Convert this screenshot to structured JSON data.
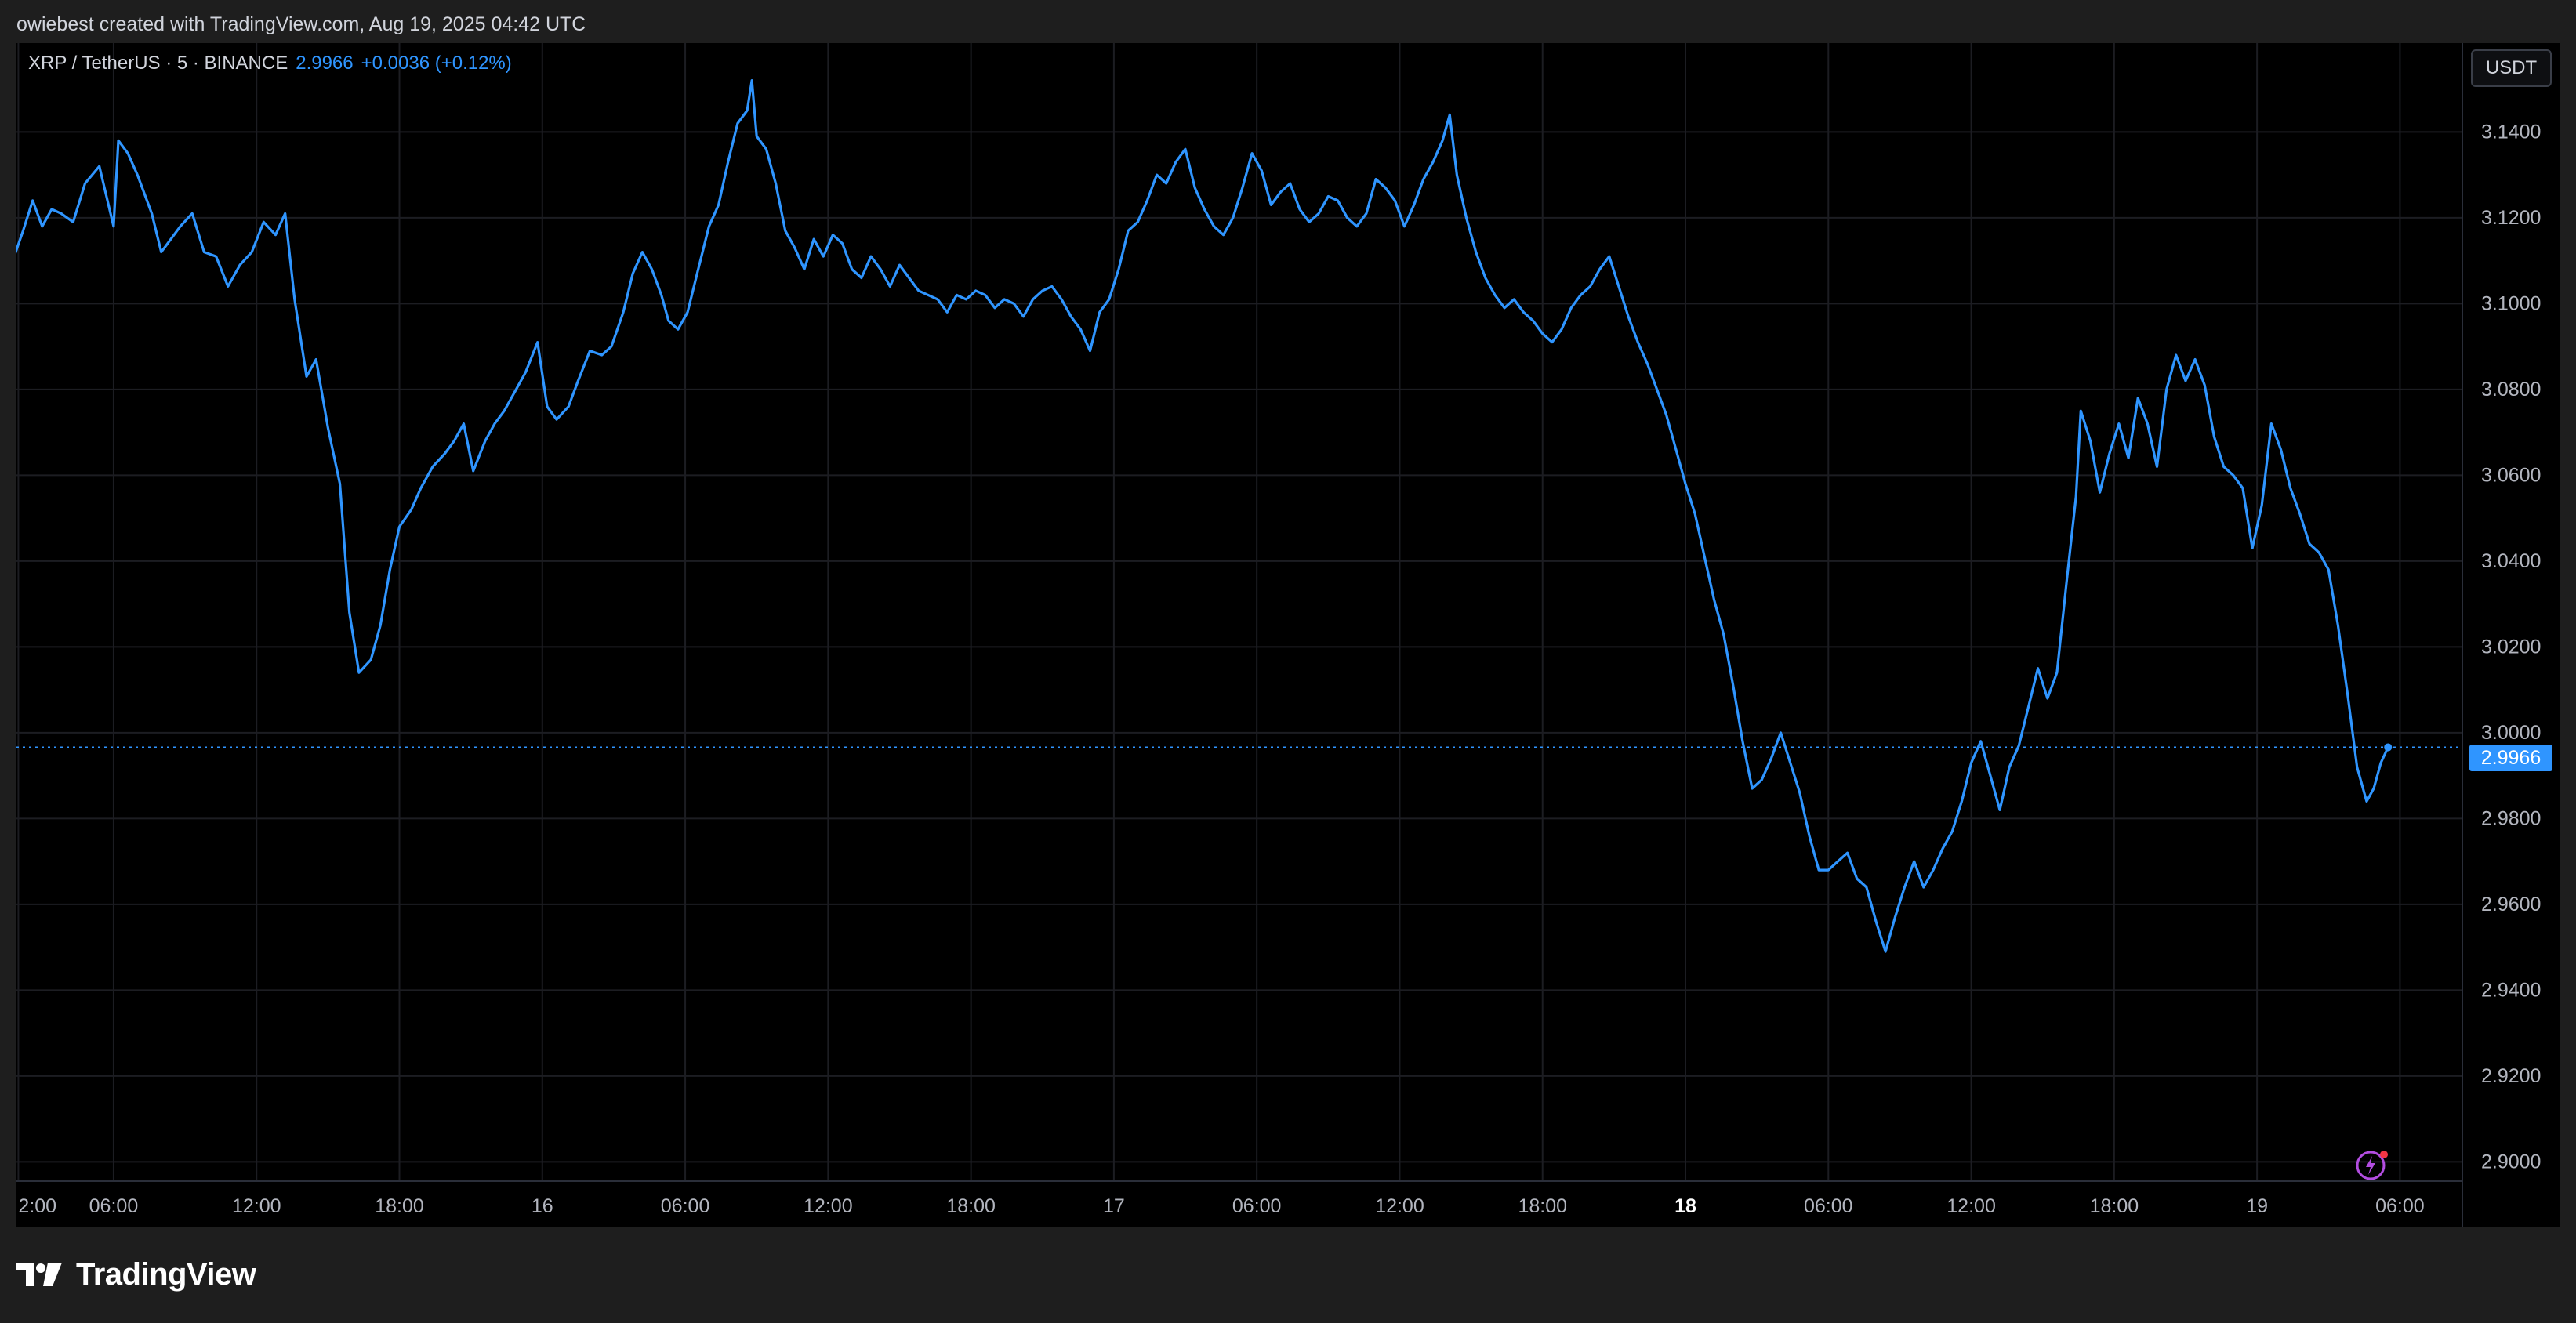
{
  "header": {
    "attribution": "owiebest created with TradingView.com, Aug 19, 2025 04:42 UTC"
  },
  "legend": {
    "symbol": "XRP / TetherUS · 5 · BINANCE",
    "price": "2.9966",
    "change": "+0.0036 (+0.12%)"
  },
  "currency_button": "USDT",
  "last_price_badge": "2.9966",
  "footer": {
    "brand": "TradingView",
    "logo_icon": "tradingview-logo-icon"
  },
  "colors": {
    "line": "#2f95ff",
    "background": "#000000",
    "grid": "#1c1d22",
    "axis_text": "#b2b5be"
  },
  "chart_data": {
    "type": "line",
    "symbol": "XRP / TetherUS",
    "interval": "5",
    "exchange": "BINANCE",
    "y_ticks": [
      "3.1400",
      "3.1200",
      "3.1000",
      "3.0800",
      "3.0600",
      "3.0400",
      "3.0200",
      "3.0000",
      "2.9800",
      "2.9600",
      "2.9400",
      "2.9200",
      "2.9000"
    ],
    "y_tick_values": [
      3.14,
      3.12,
      3.1,
      3.08,
      3.06,
      3.04,
      3.02,
      3.0,
      2.98,
      2.96,
      2.94,
      2.92,
      2.9
    ],
    "ylim": [
      2.8955,
      3.1607
    ],
    "x_ticks": [
      {
        "label": "2:00",
        "t": 2
      },
      {
        "label": "06:00",
        "t": 6
      },
      {
        "label": "12:00",
        "t": 12
      },
      {
        "label": "18:00",
        "t": 18
      },
      {
        "label": "16",
        "t": 24,
        "bold": false
      },
      {
        "label": "06:00",
        "t": 30
      },
      {
        "label": "12:00",
        "t": 36
      },
      {
        "label": "18:00",
        "t": 42
      },
      {
        "label": "17",
        "t": 48
      },
      {
        "label": "06:00",
        "t": 54
      },
      {
        "label": "12:00",
        "t": 60
      },
      {
        "label": "18:00",
        "t": 66
      },
      {
        "label": "18",
        "t": 72,
        "bold": true
      },
      {
        "label": "06:00",
        "t": 78
      },
      {
        "label": "12:00",
        "t": 84
      },
      {
        "label": "18:00",
        "t": 90
      },
      {
        "label": "19",
        "t": 96
      },
      {
        "label": "06:00",
        "t": 102
      }
    ],
    "xlim": [
      1.92,
      104.62
    ],
    "last_price": 2.9966,
    "series": [
      {
        "values": [
          [
            0.1,
            3.093
          ],
          [
            0.8,
            3.101
          ],
          [
            1.7,
            3.109
          ],
          [
            2.2,
            3.117
          ],
          [
            2.6,
            3.124
          ],
          [
            3.0,
            3.118
          ],
          [
            3.4,
            3.122
          ],
          [
            3.8,
            3.121
          ],
          [
            4.3,
            3.119
          ],
          [
            4.8,
            3.128
          ],
          [
            5.4,
            3.132
          ],
          [
            6.0,
            3.118
          ],
          [
            6.2,
            3.138
          ],
          [
            6.6,
            3.135
          ],
          [
            7.0,
            3.13
          ],
          [
            7.6,
            3.121
          ],
          [
            8.0,
            3.112
          ],
          [
            8.4,
            3.115
          ],
          [
            8.8,
            3.118
          ],
          [
            9.3,
            3.121
          ],
          [
            9.8,
            3.112
          ],
          [
            10.3,
            3.111
          ],
          [
            10.8,
            3.104
          ],
          [
            11.3,
            3.109
          ],
          [
            11.8,
            3.112
          ],
          [
            12.3,
            3.119
          ],
          [
            12.8,
            3.116
          ],
          [
            13.2,
            3.121
          ],
          [
            13.6,
            3.101
          ],
          [
            14.1,
            3.083
          ],
          [
            14.5,
            3.087
          ],
          [
            15.0,
            3.071
          ],
          [
            15.5,
            3.058
          ],
          [
            15.9,
            3.028
          ],
          [
            16.3,
            3.014
          ],
          [
            16.8,
            3.017
          ],
          [
            17.2,
            3.025
          ],
          [
            17.6,
            3.038
          ],
          [
            18.0,
            3.048
          ],
          [
            18.5,
            3.052
          ],
          [
            18.9,
            3.057
          ],
          [
            19.4,
            3.062
          ],
          [
            19.9,
            3.065
          ],
          [
            20.3,
            3.068
          ],
          [
            20.7,
            3.072
          ],
          [
            21.1,
            3.061
          ],
          [
            21.6,
            3.068
          ],
          [
            22.0,
            3.072
          ],
          [
            22.4,
            3.075
          ],
          [
            22.9,
            3.08
          ],
          [
            23.3,
            3.084
          ],
          [
            23.8,
            3.091
          ],
          [
            24.2,
            3.076
          ],
          [
            24.6,
            3.073
          ],
          [
            25.1,
            3.076
          ],
          [
            25.5,
            3.082
          ],
          [
            26.0,
            3.089
          ],
          [
            26.5,
            3.088
          ],
          [
            26.9,
            3.09
          ],
          [
            27.4,
            3.098
          ],
          [
            27.8,
            3.107
          ],
          [
            28.2,
            3.112
          ],
          [
            28.6,
            3.108
          ],
          [
            29.0,
            3.102
          ],
          [
            29.3,
            3.096
          ],
          [
            29.7,
            3.094
          ],
          [
            30.1,
            3.098
          ],
          [
            30.5,
            3.107
          ],
          [
            31.0,
            3.118
          ],
          [
            31.4,
            3.123
          ],
          [
            31.8,
            3.133
          ],
          [
            32.2,
            3.142
          ],
          [
            32.6,
            3.145
          ],
          [
            32.8,
            3.152
          ],
          [
            33.0,
            3.139
          ],
          [
            33.4,
            3.136
          ],
          [
            33.8,
            3.128
          ],
          [
            34.2,
            3.117
          ],
          [
            34.6,
            3.113
          ],
          [
            35.0,
            3.108
          ],
          [
            35.4,
            3.115
          ],
          [
            35.8,
            3.111
          ],
          [
            36.2,
            3.116
          ],
          [
            36.6,
            3.114
          ],
          [
            37.0,
            3.108
          ],
          [
            37.4,
            3.106
          ],
          [
            37.8,
            3.111
          ],
          [
            38.2,
            3.108
          ],
          [
            38.6,
            3.104
          ],
          [
            39.0,
            3.109
          ],
          [
            39.4,
            3.106
          ],
          [
            39.8,
            3.103
          ],
          [
            40.2,
            3.102
          ],
          [
            40.6,
            3.101
          ],
          [
            41.0,
            3.098
          ],
          [
            41.4,
            3.102
          ],
          [
            41.8,
            3.101
          ],
          [
            42.2,
            3.103
          ],
          [
            42.6,
            3.102
          ],
          [
            43.0,
            3.099
          ],
          [
            43.4,
            3.101
          ],
          [
            43.8,
            3.1
          ],
          [
            44.2,
            3.097
          ],
          [
            44.6,
            3.101
          ],
          [
            45.0,
            3.103
          ],
          [
            45.4,
            3.104
          ],
          [
            45.8,
            3.101
          ],
          [
            46.2,
            3.097
          ],
          [
            46.6,
            3.094
          ],
          [
            47.0,
            3.089
          ],
          [
            47.4,
            3.098
          ],
          [
            47.8,
            3.101
          ],
          [
            48.2,
            3.108
          ],
          [
            48.6,
            3.117
          ],
          [
            49.0,
            3.119
          ],
          [
            49.4,
            3.124
          ],
          [
            49.8,
            3.13
          ],
          [
            50.2,
            3.128
          ],
          [
            50.6,
            3.133
          ],
          [
            51.0,
            3.136
          ],
          [
            51.4,
            3.127
          ],
          [
            51.8,
            3.122
          ],
          [
            52.2,
            3.118
          ],
          [
            52.6,
            3.116
          ],
          [
            53.0,
            3.12
          ],
          [
            53.4,
            3.127
          ],
          [
            53.8,
            3.135
          ],
          [
            54.2,
            3.131
          ],
          [
            54.6,
            3.123
          ],
          [
            55.0,
            3.126
          ],
          [
            55.4,
            3.128
          ],
          [
            55.8,
            3.122
          ],
          [
            56.2,
            3.119
          ],
          [
            56.6,
            3.121
          ],
          [
            57.0,
            3.125
          ],
          [
            57.4,
            3.124
          ],
          [
            57.8,
            3.12
          ],
          [
            58.2,
            3.118
          ],
          [
            58.6,
            3.121
          ],
          [
            59.0,
            3.129
          ],
          [
            59.4,
            3.127
          ],
          [
            59.8,
            3.124
          ],
          [
            60.2,
            3.118
          ],
          [
            60.6,
            3.123
          ],
          [
            61.0,
            3.129
          ],
          [
            61.4,
            3.133
          ],
          [
            61.8,
            3.138
          ],
          [
            62.1,
            3.144
          ],
          [
            62.4,
            3.13
          ],
          [
            62.8,
            3.12
          ],
          [
            63.2,
            3.112
          ],
          [
            63.6,
            3.106
          ],
          [
            64.0,
            3.102
          ],
          [
            64.4,
            3.099
          ],
          [
            64.8,
            3.101
          ],
          [
            65.2,
            3.098
          ],
          [
            65.6,
            3.096
          ],
          [
            66.0,
            3.093
          ],
          [
            66.4,
            3.091
          ],
          [
            66.8,
            3.094
          ],
          [
            67.2,
            3.099
          ],
          [
            67.6,
            3.102
          ],
          [
            68.0,
            3.104
          ],
          [
            68.4,
            3.108
          ],
          [
            68.8,
            3.111
          ],
          [
            69.2,
            3.104
          ],
          [
            69.6,
            3.097
          ],
          [
            70.0,
            3.091
          ],
          [
            70.4,
            3.086
          ],
          [
            70.8,
            3.08
          ],
          [
            71.2,
            3.074
          ],
          [
            71.6,
            3.066
          ],
          [
            72.0,
            3.058
          ],
          [
            72.4,
            3.051
          ],
          [
            72.8,
            3.041
          ],
          [
            73.2,
            3.031
          ],
          [
            73.6,
            3.023
          ],
          [
            74.0,
            3.011
          ],
          [
            74.4,
            2.998
          ],
          [
            74.8,
            2.987
          ],
          [
            75.2,
            2.989
          ],
          [
            75.6,
            2.994
          ],
          [
            76.0,
            3.0
          ],
          [
            76.4,
            2.993
          ],
          [
            76.8,
            2.986
          ],
          [
            77.2,
            2.976
          ],
          [
            77.6,
            2.968
          ],
          [
            78.0,
            2.968
          ],
          [
            78.4,
            2.97
          ],
          [
            78.8,
            2.972
          ],
          [
            79.2,
            2.966
          ],
          [
            79.6,
            2.964
          ],
          [
            80.0,
            2.956
          ],
          [
            80.4,
            2.949
          ],
          [
            80.8,
            2.957
          ],
          [
            81.2,
            2.964
          ],
          [
            81.6,
            2.97
          ],
          [
            82.0,
            2.964
          ],
          [
            82.4,
            2.968
          ],
          [
            82.8,
            2.973
          ],
          [
            83.2,
            2.977
          ],
          [
            83.6,
            2.984
          ],
          [
            84.0,
            2.993
          ],
          [
            84.4,
            2.998
          ],
          [
            84.8,
            2.99
          ],
          [
            85.2,
            2.982
          ],
          [
            85.6,
            2.992
          ],
          [
            86.0,
            2.997
          ],
          [
            86.4,
            3.006
          ],
          [
            86.8,
            3.015
          ],
          [
            87.2,
            3.008
          ],
          [
            87.6,
            3.014
          ],
          [
            88.0,
            3.035
          ],
          [
            88.4,
            3.055
          ],
          [
            88.6,
            3.075
          ],
          [
            89.0,
            3.068
          ],
          [
            89.4,
            3.056
          ],
          [
            89.8,
            3.065
          ],
          [
            90.2,
            3.072
          ],
          [
            90.6,
            3.064
          ],
          [
            91.0,
            3.078
          ],
          [
            91.4,
            3.072
          ],
          [
            91.8,
            3.062
          ],
          [
            92.2,
            3.08
          ],
          [
            92.6,
            3.088
          ],
          [
            93.0,
            3.082
          ],
          [
            93.4,
            3.087
          ],
          [
            93.8,
            3.081
          ],
          [
            94.2,
            3.069
          ],
          [
            94.6,
            3.062
          ],
          [
            95.0,
            3.06
          ],
          [
            95.4,
            3.057
          ],
          [
            95.8,
            3.043
          ],
          [
            96.2,
            3.053
          ],
          [
            96.6,
            3.072
          ],
          [
            97.0,
            3.066
          ],
          [
            97.4,
            3.057
          ],
          [
            97.8,
            3.051
          ],
          [
            98.2,
            3.044
          ],
          [
            98.6,
            3.042
          ],
          [
            99.0,
            3.038
          ],
          [
            99.4,
            3.025
          ],
          [
            99.8,
            3.009
          ],
          [
            100.2,
            2.992
          ],
          [
            100.6,
            2.984
          ],
          [
            100.9,
            2.987
          ],
          [
            101.2,
            2.993
          ],
          [
            101.5,
            2.9966
          ]
        ]
      }
    ]
  }
}
